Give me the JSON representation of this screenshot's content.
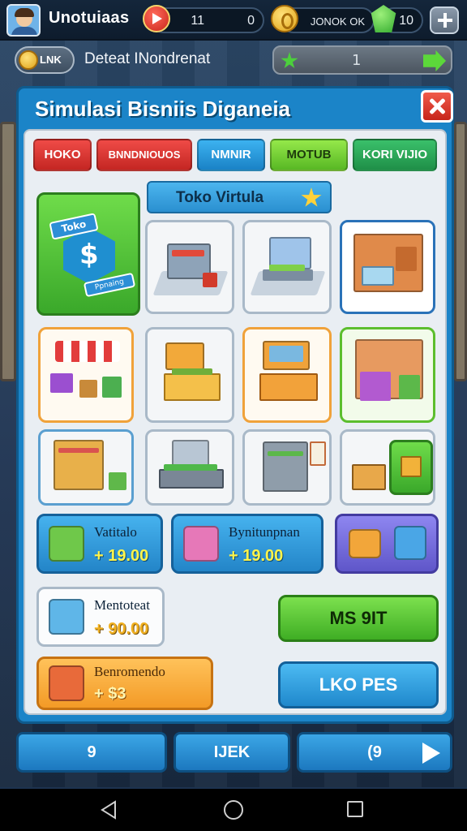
{
  "topbar": {
    "username": "Unotuiaas",
    "resource_red": "11",
    "resource_gold_left": "0",
    "resource_gold": "JONOK OK",
    "resource_gem": "10"
  },
  "quest": {
    "badge_label": "LNK",
    "text": "Deteat INondrenat",
    "progress": "1"
  },
  "panel": {
    "title": "Simulasi Bisniis Diganeia",
    "tabs": [
      {
        "label": "HOKO"
      },
      {
        "label": "BNNDNIOUOS"
      },
      {
        "label": "NMNIR"
      },
      {
        "label": "MOTUB"
      },
      {
        "label": "KORI VIJIO"
      }
    ],
    "section_title": "Toko Virtula",
    "shop_badge": {
      "ribbon_top": "Toko",
      "ribbon_bottom": "Ppnaing"
    },
    "cards": [
      {
        "name": "Vatitalo",
        "price": "+ 19.00"
      },
      {
        "name": "Bynitunpnan",
        "price": "+ 19.00"
      },
      {
        "name": "Mentoteat",
        "price": "+ 90.00"
      },
      {
        "name": "Benromendo",
        "price": "+ $3"
      }
    ],
    "buttons": {
      "primary": "MS 9IT",
      "secondary": "LKO PES"
    }
  },
  "bottom_nav": {
    "left": "9",
    "center": "IJEK",
    "right": "(9"
  },
  "colors": {
    "panel_blue": "#1b84c8",
    "tab_red": "#ef4b47",
    "tab_blue": "#3cb2f0",
    "tab_lime": "#95e84a",
    "tab_green": "#3ac06a",
    "accent_green": "#3fae24"
  },
  "icons": {
    "system_back": "back-triangle-icon",
    "system_home": "home-circle-icon",
    "system_recent": "recent-square-icon"
  }
}
